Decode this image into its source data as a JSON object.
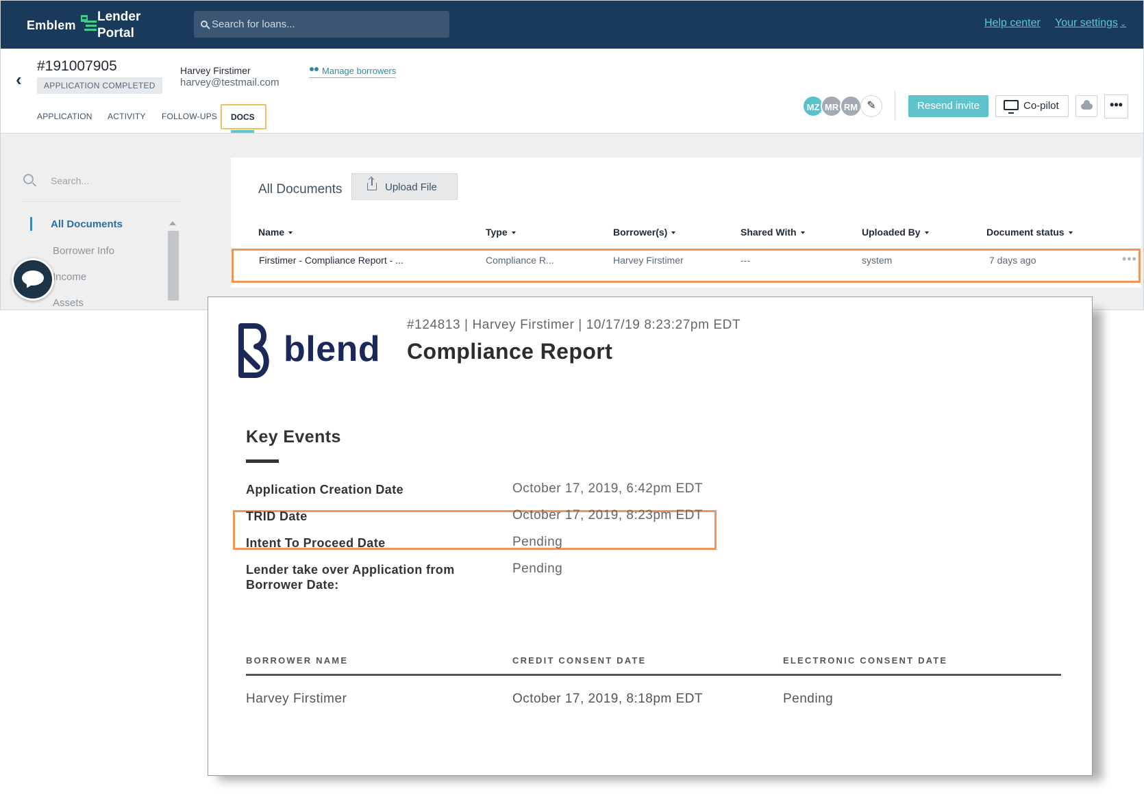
{
  "topbar": {
    "logo_left": "Emblem",
    "logo_line1": "Lender",
    "logo_line2": "Portal",
    "search_placeholder": "Search for loans...",
    "help_link": "Help center",
    "settings_link": "Your settings"
  },
  "loan": {
    "number": "#191007905",
    "status_badge": "APPLICATION COMPLETED",
    "borrower_name": "Harvey Firstimer",
    "borrower_email": "harvey@testmail.com",
    "manage_borrowers": "Manage borrowers"
  },
  "tabs": [
    {
      "label": "APPLICATION"
    },
    {
      "label": "ACTIVITY"
    },
    {
      "label": "FOLLOW-UPS"
    },
    {
      "label": "DOCS"
    }
  ],
  "team": {
    "avatars": [
      {
        "initials": "MZ",
        "color": "#56c2ca"
      },
      {
        "initials": "MR",
        "color": "#a2aab3"
      },
      {
        "initials": "RM",
        "color": "#a2aab3"
      }
    ],
    "edit_icon": "pencil-icon"
  },
  "actions": {
    "resend_invite": "Resend invite",
    "copilot": "Co-pilot",
    "more": "•••"
  },
  "sidebar": {
    "search_placeholder": "Search...",
    "items": [
      {
        "label": "All Documents"
      },
      {
        "label": "Borrower Info"
      },
      {
        "label": "Income"
      },
      {
        "label": "Assets"
      }
    ]
  },
  "documents": {
    "title": "All Documents",
    "upload_label": "Upload File",
    "columns": [
      "Name",
      "Type",
      "Borrower(s)",
      "Shared With",
      "Uploaded By",
      "Document status"
    ],
    "rows": [
      {
        "name": "Firstimer - Compliance Report - ...",
        "type": "Compliance R...",
        "borrowers": "Harvey Firstimer",
        "shared_with": "---",
        "uploaded_by": "system",
        "status": "7 days ago"
      }
    ],
    "row_menu": "•••"
  },
  "report": {
    "brand": "blend",
    "meta": "#124813  |  Harvey Firstimer  |  10/17/19 8:23:27pm EDT",
    "title": "Compliance Report",
    "key_events_heading": "Key Events",
    "events": [
      {
        "label": "Application Creation Date",
        "value": "October 17, 2019, 6:42pm EDT"
      },
      {
        "label": "TRID Date",
        "value": "October 17, 2019, 8:23pm EDT"
      },
      {
        "label": "Intent To Proceed Date",
        "value": "Pending"
      },
      {
        "label_line1": "Lender take over Application from",
        "label_line2": "Borrower Date:",
        "value": "Pending"
      }
    ],
    "consent_columns": [
      "BORROWER NAME",
      "CREDIT CONSENT DATE",
      "ELECTRONIC CONSENT DATE"
    ],
    "consent_rows": [
      {
        "borrower": "Harvey Firstimer",
        "credit": "October 17, 2019, 8:18pm EDT",
        "electronic": "Pending"
      }
    ]
  },
  "colors": {
    "navy": "#193a5a",
    "teal": "#5ec3cb",
    "highlight_orange": "#f0955a",
    "tab_highlight_yellow": "#f0c060",
    "blend_navy": "#1b2858"
  }
}
